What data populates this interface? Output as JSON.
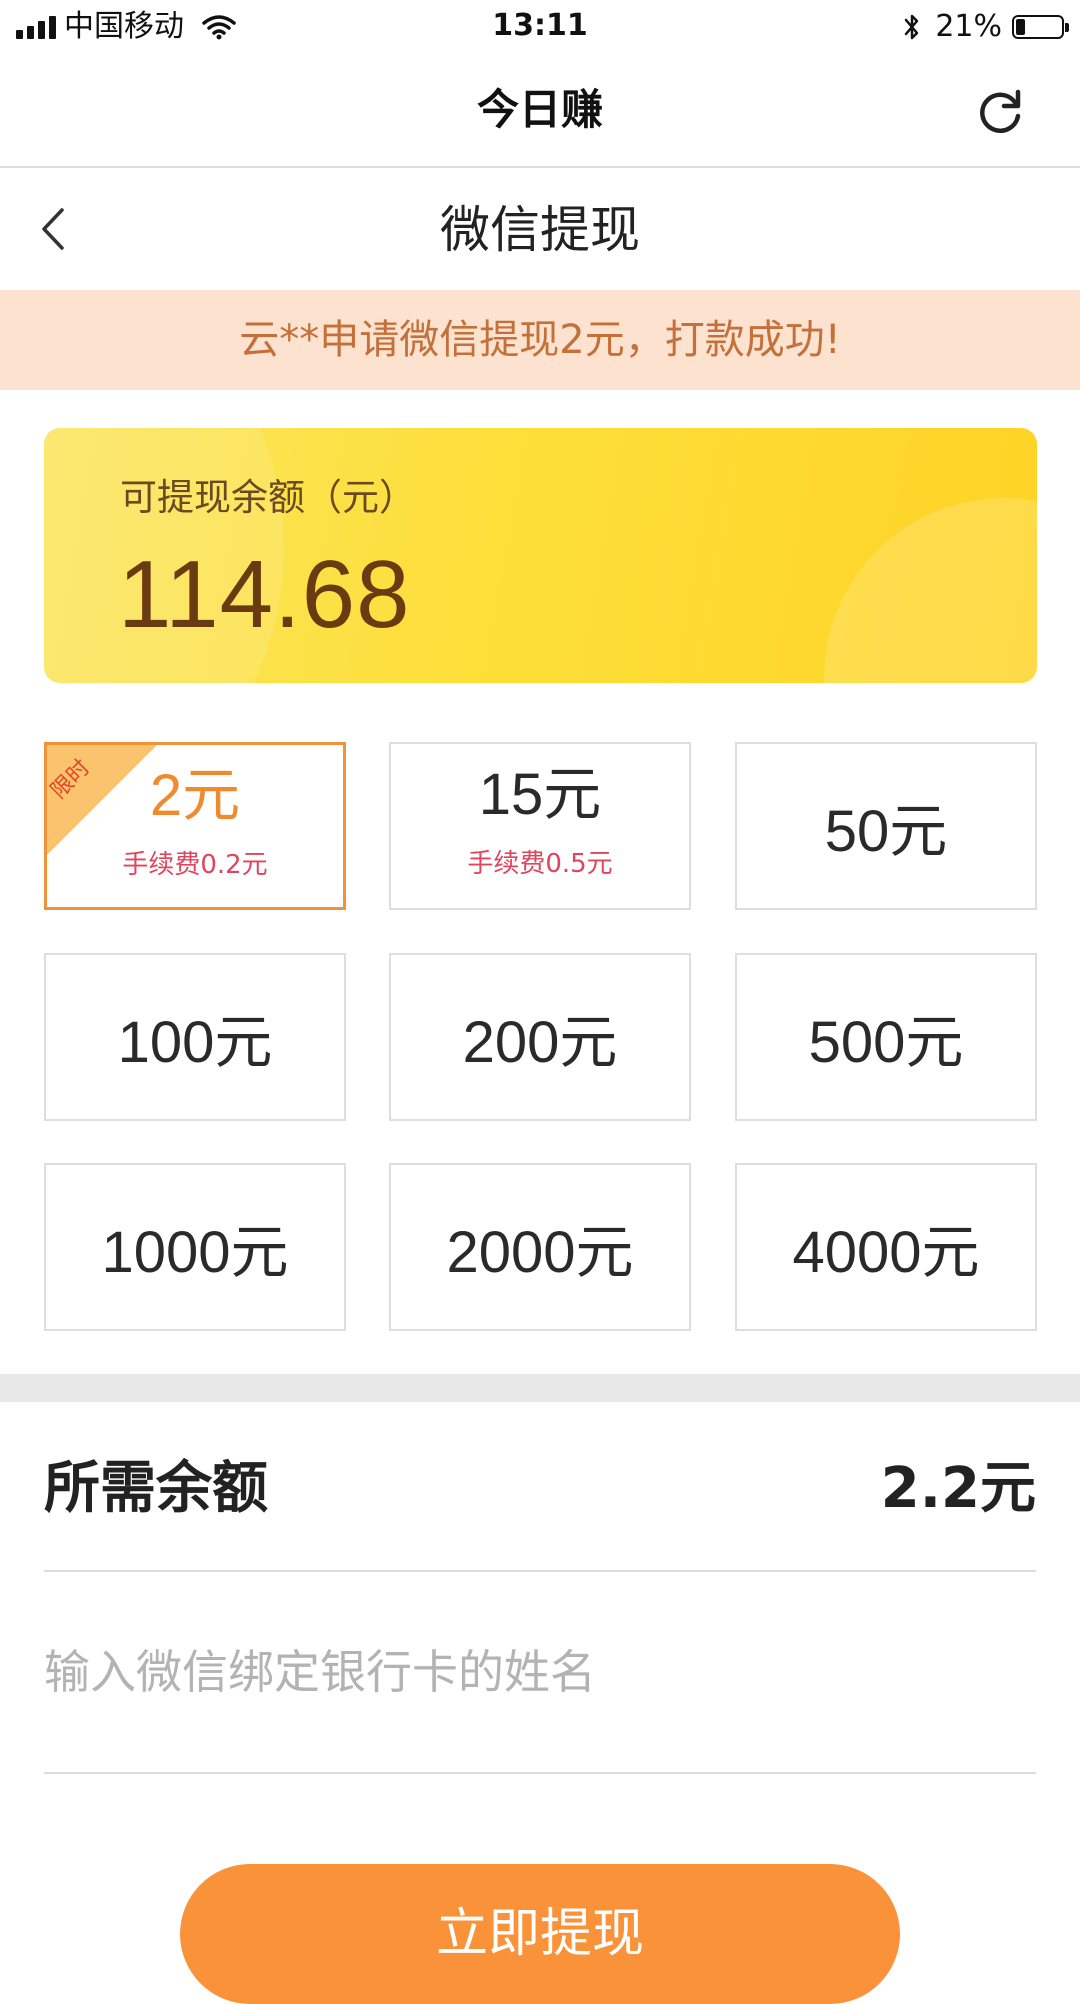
{
  "status_bar": {
    "carrier": "中国移动",
    "time": "13:11",
    "battery_pct": "21%",
    "battery_level": 0.21,
    "icons": [
      "signal-icon",
      "wifi-icon",
      "bluetooth-icon",
      "battery-icon"
    ]
  },
  "header": {
    "app_title": "今日赚",
    "refresh_icon": "refresh-icon"
  },
  "page": {
    "title": "微信提现",
    "back_icon": "chevron-left-icon"
  },
  "notice": {
    "text": "云**申请微信提现2元，打款成功!"
  },
  "balance": {
    "label": "可提现余额（元）",
    "amount": "114.68"
  },
  "options": [
    {
      "amount": "2元",
      "fee": "手续费0.2元",
      "tag": "限时",
      "selected": true
    },
    {
      "amount": "15元",
      "fee": "手续费0.5元",
      "selected": false
    },
    {
      "amount": "50元",
      "selected": false
    },
    {
      "amount": "100元",
      "selected": false
    },
    {
      "amount": "200元",
      "selected": false
    },
    {
      "amount": "500元",
      "selected": false
    },
    {
      "amount": "1000元",
      "selected": false
    },
    {
      "amount": "2000元",
      "selected": false
    },
    {
      "amount": "4000元",
      "selected": false
    }
  ],
  "required": {
    "label": "所需余额",
    "value": "2.2元"
  },
  "name_input": {
    "placeholder": "输入微信绑定银行卡的姓名",
    "value": ""
  },
  "submit": {
    "label": "立即提现"
  },
  "colors": {
    "accent": "#f99238",
    "notice_bg": "#fde3cf",
    "notice_text": "#c4703a",
    "fee_text": "#e0455d",
    "card_yellow": "#fed325"
  }
}
